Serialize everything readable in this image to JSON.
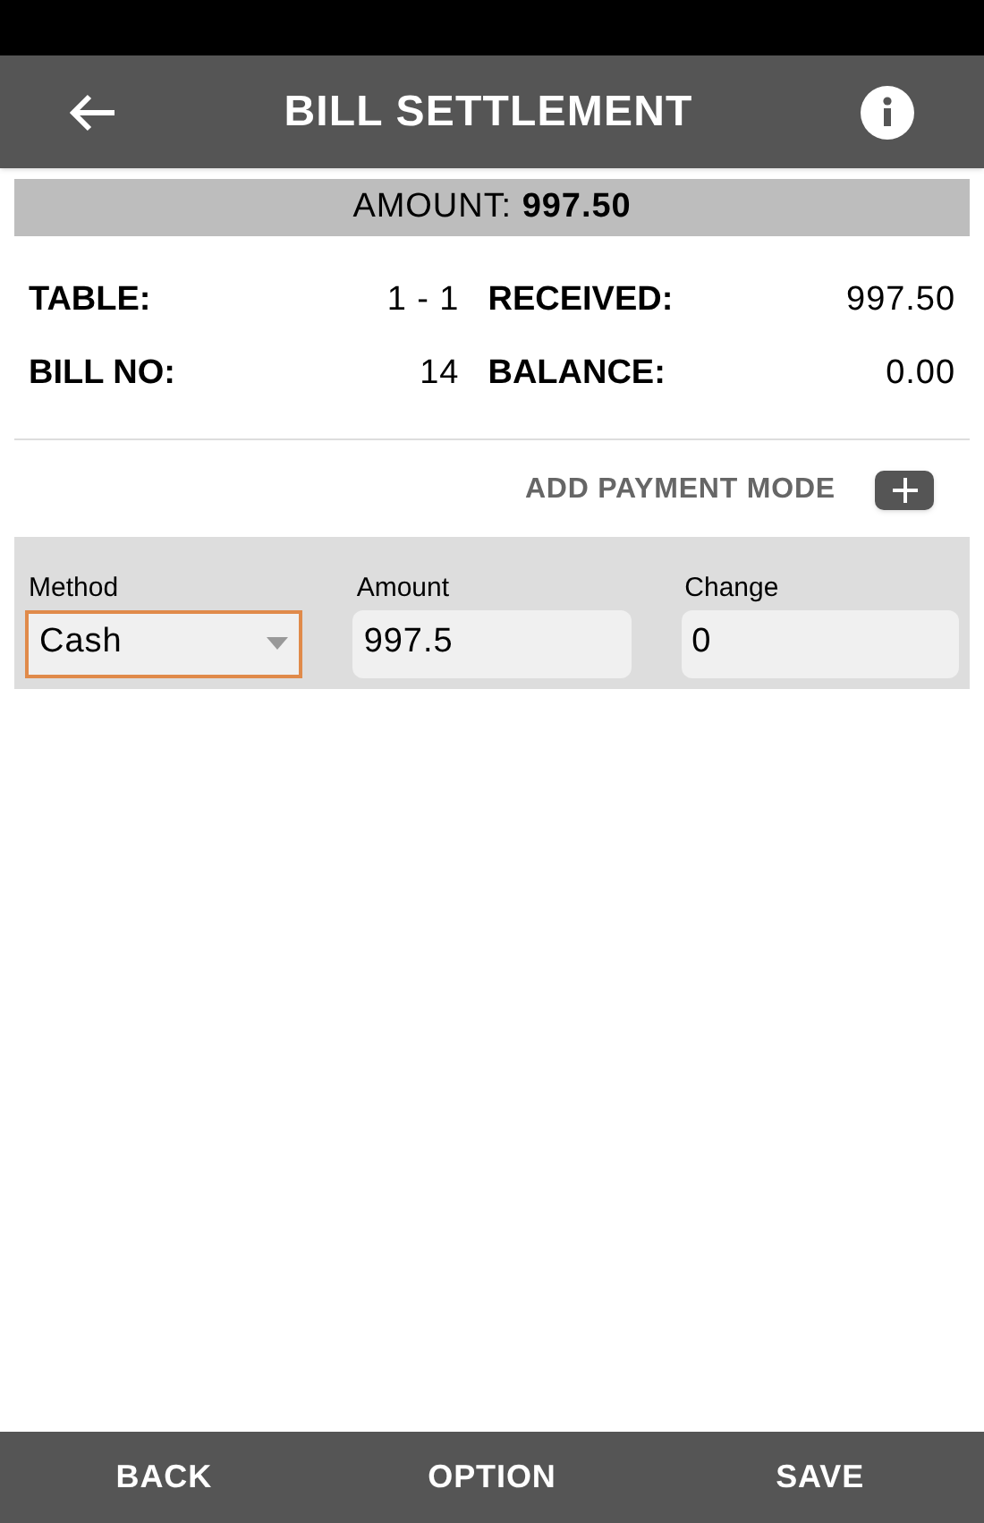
{
  "header": {
    "title": "BILL SETTLEMENT"
  },
  "amount_bar": {
    "text": "AMOUNT: **997.50**"
  },
  "summary": [
    {
      "label": "TABLE:",
      "value": "1 - 1"
    },
    {
      "label": "RECEIVED:",
      "value": "997.50"
    },
    {
      "label": "BILL NO:",
      "value": "14"
    },
    {
      "label": "BALANCE:",
      "value": "0.00"
    }
  ],
  "add_payment_mode": {
    "label": "ADD PAYMENT MODE"
  },
  "payment_fields": [
    {
      "kind": "select",
      "label": "Method",
      "value": "Cash",
      "focused": true
    },
    {
      "kind": "input",
      "label": "Amount",
      "value": "997.5",
      "focused": false
    },
    {
      "kind": "input",
      "label": "Change",
      "value": "0",
      "focused": false
    }
  ],
  "bottom_bar": [
    "BACK",
    "OPTION",
    "SAVE"
  ]
}
